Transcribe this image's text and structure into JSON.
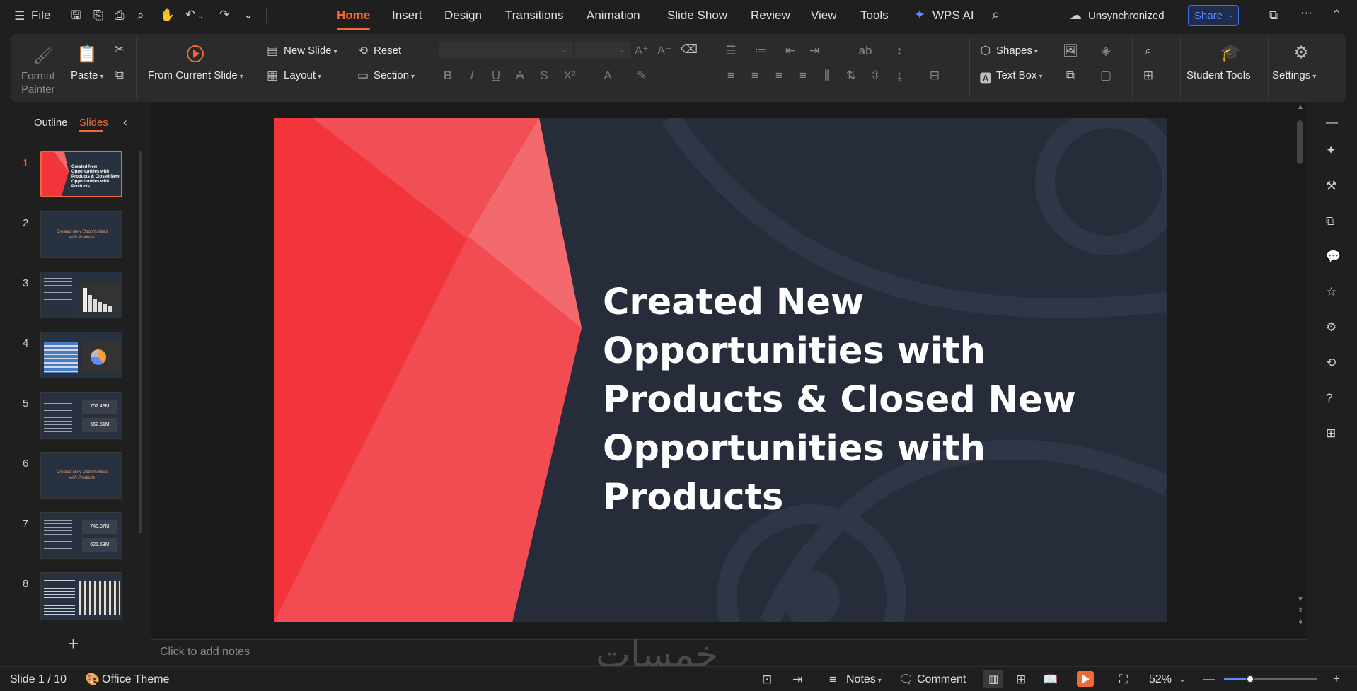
{
  "menubar": {
    "file_label": "File",
    "tabs": [
      "Home",
      "Insert",
      "Design",
      "Transitions",
      "Animation",
      "Slide Show",
      "Review",
      "View",
      "Tools"
    ],
    "active_tab": "Home",
    "wps_ai_label": "WPS AI",
    "sync_label": "Unsynchronized",
    "share_label": "Share"
  },
  "ribbon": {
    "format_painter_label": "Format\nPainter",
    "paste_label": "Paste",
    "from_current_slide_label": "From Current Slide",
    "new_slide_label": "New  Slide",
    "layout_label": "Layout",
    "reset_label": "Reset",
    "section_label": "Section",
    "shapes_label": "Shapes",
    "text_box_label": "Text Box",
    "student_tools_label": "Student Tools",
    "settings_label": "Settings"
  },
  "leftpane": {
    "tab_outline": "Outline",
    "tab_slides": "Slides",
    "slides": [
      "1",
      "2",
      "3",
      "4",
      "5",
      "6",
      "7",
      "8"
    ],
    "current_slide": "1",
    "thumb2_text": "Created New Opportunities with Products",
    "thumb5_values": [
      "702.48M",
      "562.51M"
    ],
    "thumb7_values": [
      "745.07M",
      "621.53M"
    ]
  },
  "slide": {
    "title": "Created New Opportunities with Products & Closed New Opportunities with Products",
    "thumb1_text": "Created New Opportunities with Products & Closed New Opportunities with Products"
  },
  "notes": {
    "placeholder": "Click to add notes"
  },
  "status": {
    "slide_info": "Slide 1 / 10",
    "theme": "Office Theme",
    "notes_label": "Notes",
    "comment_label": "Comment",
    "zoom": "52%"
  },
  "watermark": "خمسات",
  "colors": {
    "accent": "#f06a35",
    "slide_bg": "#262c39",
    "red_main": "#f2353b",
    "red_light": "#f25a5f"
  }
}
